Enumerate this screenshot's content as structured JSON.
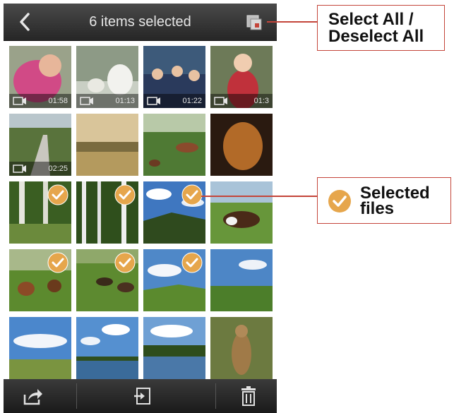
{
  "header": {
    "title": "6 items selected",
    "back_icon": "chevron-left-icon",
    "select_all_icon": "select-all-icon"
  },
  "thumbnails": [
    {
      "scene": "child-pink",
      "video": true,
      "duration": "01:58",
      "selected": false
    },
    {
      "scene": "geese",
      "video": true,
      "duration": "01:13",
      "selected": false
    },
    {
      "scene": "crowd",
      "video": true,
      "duration": "01:22",
      "selected": false
    },
    {
      "scene": "girl-red",
      "video": true,
      "duration": "01:3",
      "selected": false
    },
    {
      "scene": "road-trees",
      "video": true,
      "duration": "02:25",
      "selected": false
    },
    {
      "scene": "misty-field",
      "video": false,
      "duration": "",
      "selected": false
    },
    {
      "scene": "horses-meadow",
      "video": false,
      "duration": "",
      "selected": false
    },
    {
      "scene": "dog-dark",
      "video": false,
      "duration": "",
      "selected": false
    },
    {
      "scene": "birch-a",
      "video": false,
      "duration": "",
      "selected": true
    },
    {
      "scene": "birch-b",
      "video": false,
      "duration": "",
      "selected": true
    },
    {
      "scene": "hills-sky",
      "video": false,
      "duration": "",
      "selected": true
    },
    {
      "scene": "cow",
      "video": false,
      "duration": "",
      "selected": false
    },
    {
      "scene": "horses-grass",
      "video": false,
      "duration": "",
      "selected": true
    },
    {
      "scene": "cattle",
      "video": false,
      "duration": "",
      "selected": true
    },
    {
      "scene": "meadow-clouds",
      "video": false,
      "duration": "",
      "selected": true
    },
    {
      "scene": "green-plain",
      "video": false,
      "duration": "",
      "selected": false
    },
    {
      "scene": "sky-path",
      "video": false,
      "duration": "",
      "selected": false
    },
    {
      "scene": "lake-clouds",
      "video": false,
      "duration": "",
      "selected": false
    },
    {
      "scene": "lake-trees",
      "video": false,
      "duration": "",
      "selected": false
    },
    {
      "scene": "meerkat",
      "video": false,
      "duration": "",
      "selected": false
    }
  ],
  "bottom_bar": {
    "share_icon": "share-icon",
    "move_icon": "import-icon",
    "delete_icon": "trash-icon"
  },
  "annotations": {
    "select_all_line1": "Select All /",
    "select_all_line2": "Deselect All",
    "selected_line1": "Selected",
    "selected_line2": "files"
  },
  "colors": {
    "check": "#e6a64c",
    "callout_border": "#c4453a",
    "bar_dark": "#262626"
  }
}
